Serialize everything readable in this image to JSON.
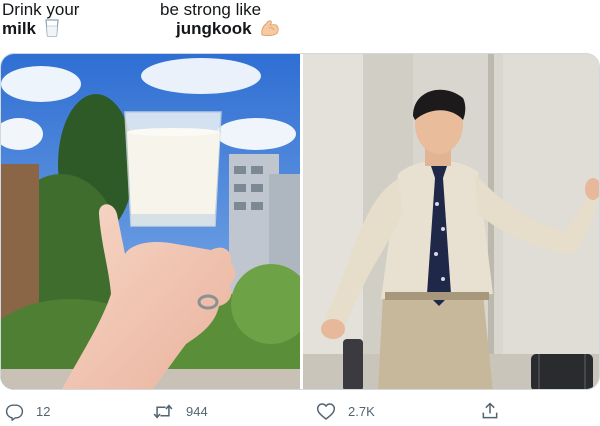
{
  "caption": {
    "left": {
      "line1": "Drink your",
      "line2": "milk",
      "emoji": "milk-glass-icon"
    },
    "right": {
      "line1": "be strong like",
      "line2": "jungkook",
      "emoji": "flexed-biceps-icon"
    }
  },
  "media": {
    "left_photo": "photo-hand-holding-milk-glass",
    "right_photo": "photo-person-flexing"
  },
  "actions": {
    "reply_count": "12",
    "retweet_count": "944",
    "like_count": "2.7K"
  },
  "colors": {
    "text": "#14171a",
    "muted": "#536471",
    "border": "#cfd9de"
  }
}
